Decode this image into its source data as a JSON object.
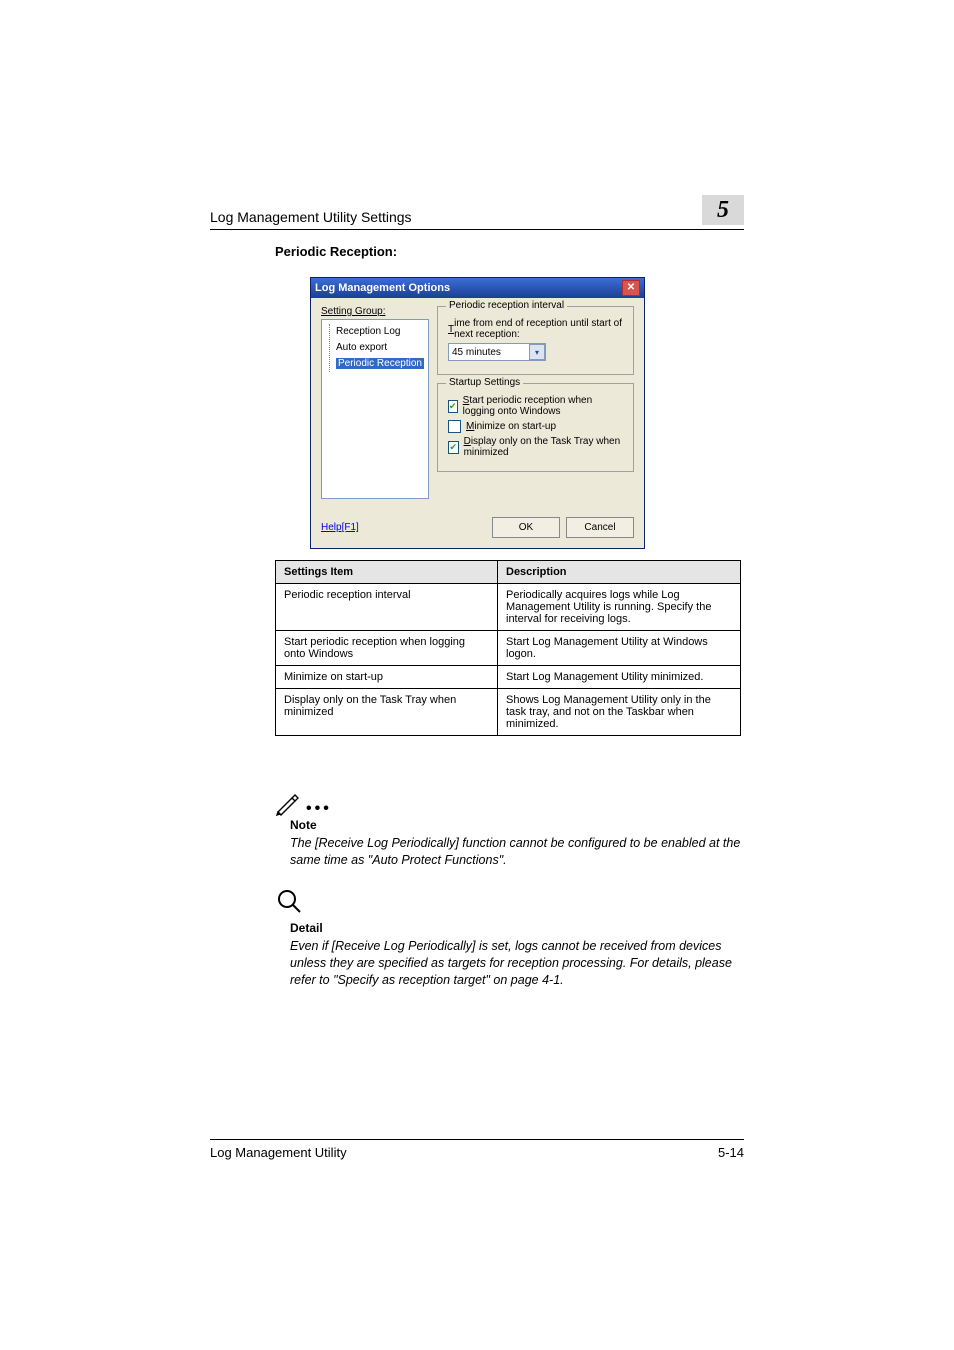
{
  "header": {
    "running_title": "Log Management Utility Settings",
    "chapter_number": "5"
  },
  "section_heading": "Periodic Reception:",
  "dialog": {
    "title": "Log Management Options",
    "group_label": "Setting Group:",
    "tree": {
      "item1": "Reception Log",
      "item2": "Auto export",
      "item3_selected": "Periodic Reception"
    },
    "fs1_legend": "Periodic reception interval",
    "fs1_label_pre": "T",
    "fs1_label_post": "ime from end of reception until start of next reception:",
    "fs1_dropdown": "45 minutes",
    "fs2_legend": "Startup Settings",
    "fs2_opt1_pre": "S",
    "fs2_opt1_post": "tart periodic reception when logging onto Windows",
    "fs2_opt2_pre": "M",
    "fs2_opt2_post": "inimize on start-up",
    "fs2_opt3_pre": "D",
    "fs2_opt3_post": "isplay only on the Task Tray when minimized",
    "help_link": "Help[F1]",
    "ok": "OK",
    "cancel": "Cancel"
  },
  "table": {
    "head_item": "Settings Item",
    "head_desc": "Description",
    "rows": [
      {
        "item": "Periodic reception interval",
        "desc": "Periodically acquires logs while Log Management Utility is running. Specify the interval for receiving logs."
      },
      {
        "item": "Start periodic reception when logging onto Windows",
        "desc": "Start Log Management Utility at Windows logon."
      },
      {
        "item": "Minimize on start-up",
        "desc": "Start Log Management Utility minimized."
      },
      {
        "item": "Display only on the Task Tray when minimized",
        "desc": "Shows Log Management Utility only in the task tray, and not on the Taskbar when minimized."
      }
    ]
  },
  "note": {
    "label": "Note",
    "body": "The [Receive Log Periodically] function cannot be configured to be enabled at the same time as \"Auto Protect Functions\"."
  },
  "detail": {
    "label": "Detail",
    "body": "Even if [Receive Log Periodically] is set, logs cannot be received from devices unless they are specified as targets for reception processing. For details, please refer to \"Specify as reception target\" on page 4-1."
  },
  "footer": {
    "left": "Log Management Utility",
    "right": "5-14"
  }
}
